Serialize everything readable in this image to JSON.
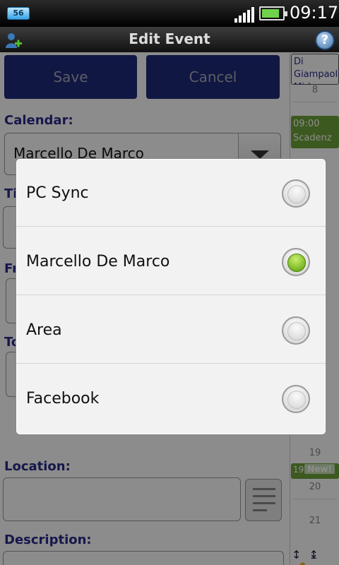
{
  "status": {
    "badge": "56",
    "time": "09:17",
    "battery_level": 0.85
  },
  "titlebar": {
    "title": "Edit Event",
    "help": "?"
  },
  "form": {
    "save_label": "Save",
    "cancel_label": "Cancel",
    "calendar_label": "Calendar:",
    "calendar_value": "Marcello De Marco",
    "title_partial": "Ti",
    "from_partial": "Fr",
    "to_partial": "To",
    "location_label": "Location:",
    "description_label": "Description:"
  },
  "strip": {
    "event1": "Di Giampaolo Mirk",
    "day8": "8",
    "event2_time": "09:00",
    "event2_title": "Scadenz",
    "day19": "19",
    "event3_badge": "New!",
    "day20": "20",
    "day21": "21"
  },
  "dialog": {
    "options": [
      {
        "label": "PC Sync",
        "selected": false
      },
      {
        "label": "Marcello De Marco",
        "selected": true
      },
      {
        "label": "Area",
        "selected": false
      },
      {
        "label": "Facebook",
        "selected": false
      }
    ]
  },
  "colors": {
    "button": "#1e2a7a",
    "label": "#2a2a8a",
    "event_green": "#6ea23a",
    "radio_selected": "#5a9c0a"
  }
}
